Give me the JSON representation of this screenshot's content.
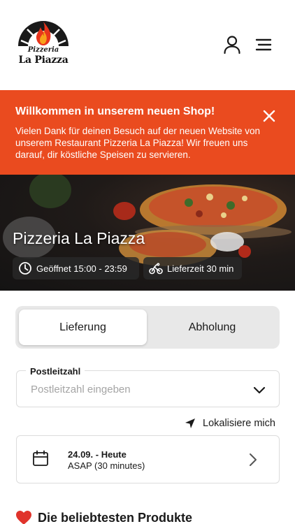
{
  "header": {
    "logo_top": "Pizzeria",
    "logo_main": "La Piazza",
    "icons": [
      "user-icon",
      "menu-icon"
    ]
  },
  "banner": {
    "title": "Willkommen in unserem neuen Shop!",
    "text": "Vielen Dank für deinen Besuch auf der neuen Website von unserem Restaurant Pizzeria La Piazza! Wir freuen uns darauf, dir köstliche Speisen zu servieren.",
    "background": "#ea4b1f"
  },
  "hero": {
    "title": "Pizzeria La Piazza",
    "opening": "Geöffnet 15:00 - 23:59",
    "delivery_time": "Lieferzeit 30 min"
  },
  "order_type": {
    "options": [
      "Lieferung",
      "Abholung"
    ],
    "selected": "Lieferung"
  },
  "postcode": {
    "label": "Postleitzahl",
    "placeholder": "Postleitzahl eingeben",
    "value": ""
  },
  "localize": {
    "label": "Lokalisiere mich"
  },
  "schedule": {
    "date": "24.09. - Heute",
    "time": "ASAP (30 minutes)"
  },
  "popular": {
    "title": "Die beliebtesten Produkte"
  }
}
